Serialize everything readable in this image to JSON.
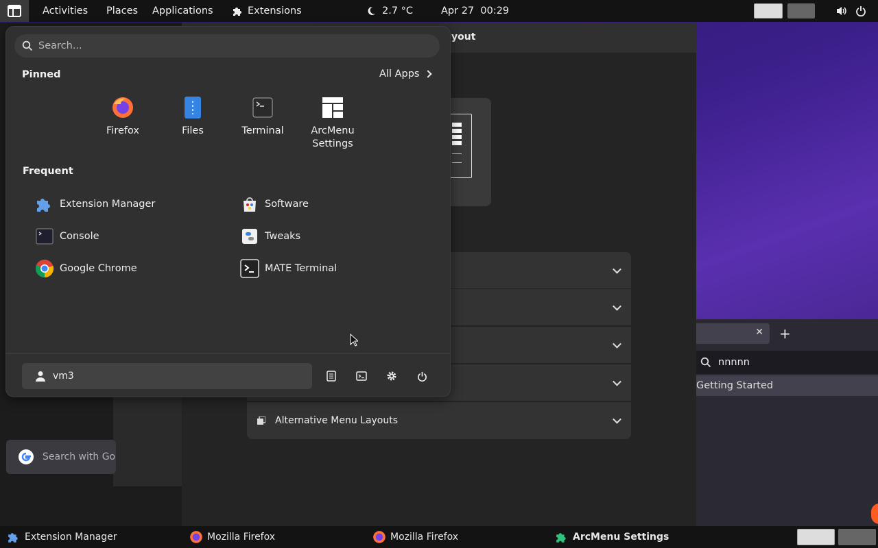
{
  "topbar": {
    "activities": "Activities",
    "places": "Places",
    "applications": "Applications",
    "extensions": "Extensions",
    "weather": "2.7 °C",
    "datetime": "Apr 27  00:29"
  },
  "background_window": {
    "title_fragment": "yout",
    "sections": [
      {
        "label": ""
      },
      {
        "label": ""
      },
      {
        "label": ""
      },
      {
        "label": ""
      },
      {
        "label": "Alternative Menu Layouts"
      }
    ]
  },
  "left_window": {
    "search_placeholder": "Search with Go"
  },
  "right_window": {
    "url_text": "nnnnn",
    "bookmark": "Getting Started"
  },
  "menu": {
    "search_placeholder": "Search...",
    "pinned_title": "Pinned",
    "all_apps": "All Apps",
    "pinned": [
      {
        "label": "Firefox",
        "icon": "firefox-icon"
      },
      {
        "label": "Files",
        "icon": "files-icon"
      },
      {
        "label": "Terminal",
        "icon": "terminal-icon"
      },
      {
        "label": "ArcMenu\nSettings",
        "icon": "arcmenu-settings-icon"
      }
    ],
    "frequent_title": "Frequent",
    "frequent": [
      {
        "label": "Extension Manager",
        "icon": "extension-manager-icon"
      },
      {
        "label": "Software",
        "icon": "software-icon"
      },
      {
        "label": "Console",
        "icon": "console-icon"
      },
      {
        "label": "Tweaks",
        "icon": "tweaks-icon"
      },
      {
        "label": "Google Chrome",
        "icon": "chrome-icon"
      },
      {
        "label": "MATE Terminal",
        "icon": "mate-terminal-icon"
      }
    ],
    "username": "vm3"
  },
  "taskbar": {
    "items": [
      {
        "label": "Extension Manager"
      },
      {
        "label": "Mozilla Firefox"
      },
      {
        "label": "Mozilla Firefox"
      },
      {
        "label": "ArcMenu Settings"
      }
    ]
  },
  "colors": {
    "panel": "#131313",
    "menu_bg": "#303030",
    "accent_blue": "#3584e4",
    "green": "#2ec27e"
  }
}
